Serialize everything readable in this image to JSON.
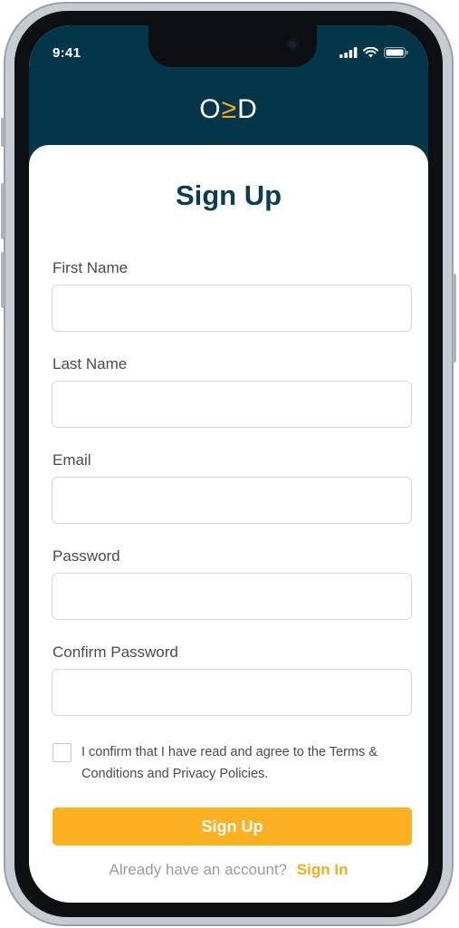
{
  "status_bar": {
    "time": "9:41"
  },
  "header": {
    "logo_left": "O",
    "logo_mid": "≥",
    "logo_right": "D"
  },
  "form": {
    "title": "Sign Up",
    "fields": [
      {
        "label": "First Name",
        "value": "",
        "placeholder": ""
      },
      {
        "label": "Last Name",
        "value": "",
        "placeholder": ""
      },
      {
        "label": "Email",
        "value": "",
        "placeholder": ""
      },
      {
        "label": "Password",
        "value": "",
        "placeholder": ""
      },
      {
        "label": "Confirm Password",
        "value": "",
        "placeholder": ""
      }
    ],
    "terms_text": "I confirm that I have read and agree to the Terms & Conditions and Privacy Policies.",
    "terms_checked": false,
    "submit_label": "Sign Up",
    "signin_prompt": "Already have an account?",
    "signin_link": "Sign In"
  },
  "colors": {
    "header_bg": "#04364a",
    "accent": "#fbb122",
    "title": "#0b3b55"
  },
  "icons": [
    "signal-icon",
    "wifi-icon",
    "battery-icon",
    "camera-icon"
  ]
}
